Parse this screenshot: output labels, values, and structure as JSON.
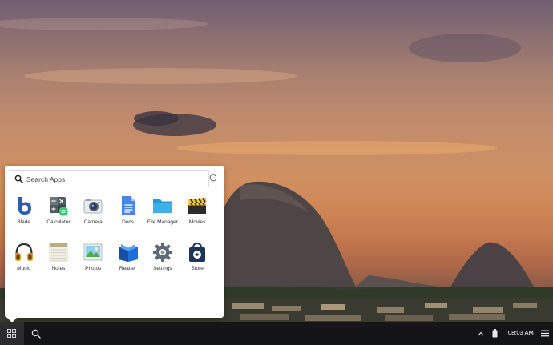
{
  "search": {
    "placeholder": "Search Apps"
  },
  "apps": [
    {
      "label": "Blade",
      "icon": "blade-icon"
    },
    {
      "label": "Calculator",
      "icon": "calculator-icon"
    },
    {
      "label": "Camera",
      "icon": "camera-icon"
    },
    {
      "label": "Docs",
      "icon": "docs-icon"
    },
    {
      "label": "File Manager",
      "icon": "folder-icon"
    },
    {
      "label": "Movies",
      "icon": "clapperboard-icon"
    },
    {
      "label": "Music",
      "icon": "headphones-icon"
    },
    {
      "label": "Notes",
      "icon": "notepad-icon"
    },
    {
      "label": "Photos",
      "icon": "photo-icon"
    },
    {
      "label": "Reader",
      "icon": "book-icon"
    },
    {
      "label": "Settings",
      "icon": "gear-icon"
    },
    {
      "label": "Store",
      "icon": "store-bag-icon"
    }
  ],
  "taskbar": {
    "time": "08:03 AM"
  },
  "colors": {
    "taskbar_bg": "#0c0e12",
    "launcher_bg": "#ffffff",
    "blade_blue": "#2a5db0",
    "docs_blue": "#4a86e8",
    "folder_blue": "#3fb0e8",
    "reader_blue": "#1e6fd9",
    "store_navy": "#1d3557"
  }
}
